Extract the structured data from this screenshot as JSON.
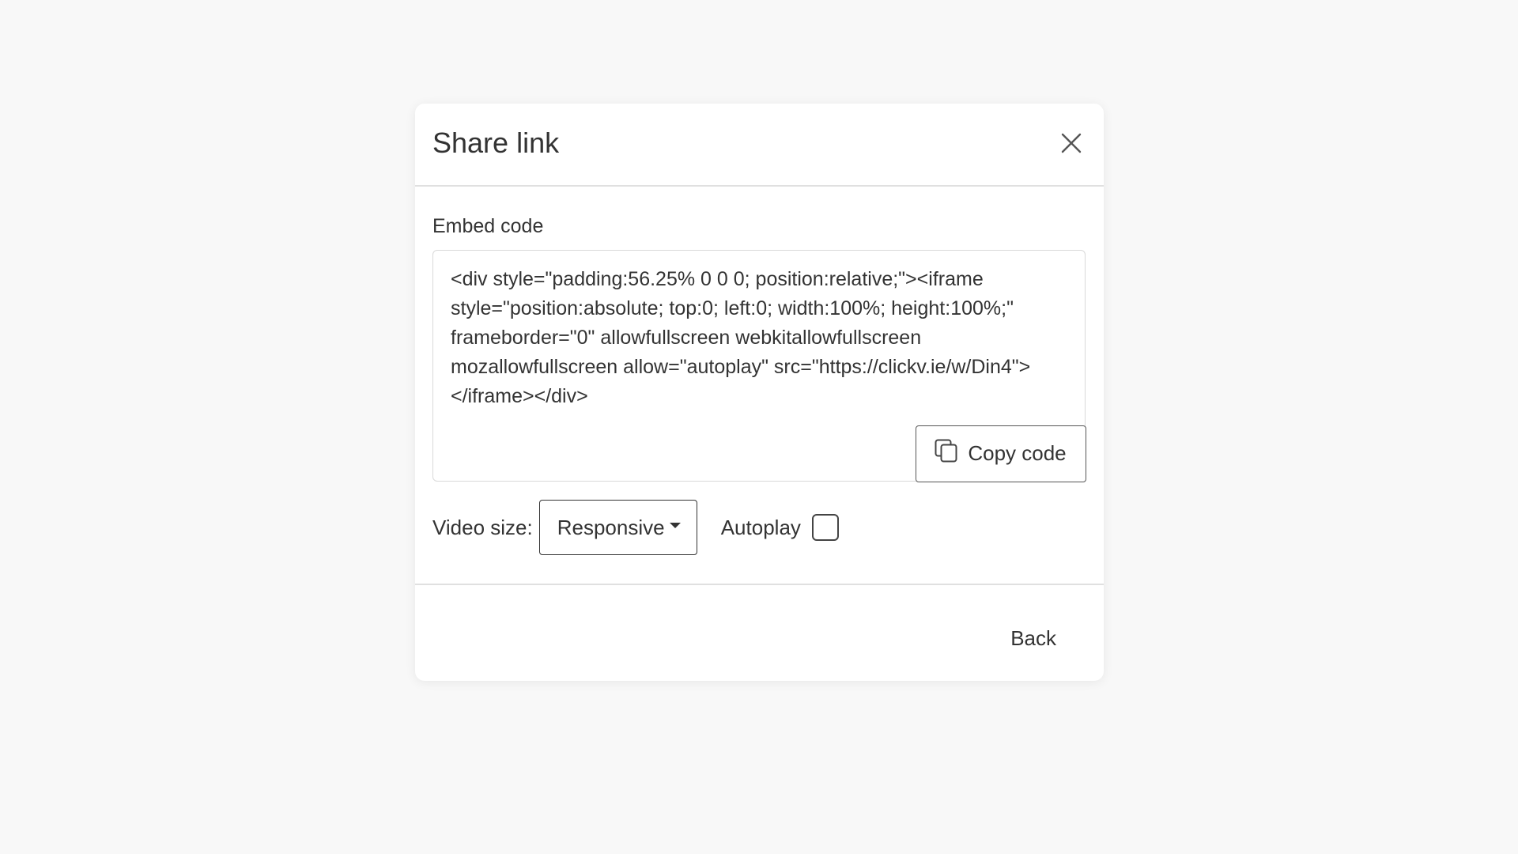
{
  "dialog": {
    "title": "Share link",
    "close_icon": "close-icon"
  },
  "embed": {
    "label": "Embed code",
    "code": "<div style=\"padding:56.25% 0 0 0; position:relative;\"><iframe style=\"position:absolute; top:0; left:0; width:100%; height:100%;\" frameborder=\"0\" allowfullscreen webkitallowfullscreen mozallowfullscreen allow=\"autoplay\" src=\"https://clickv.ie/w/Din4\"></iframe></div>",
    "copy_label": "Copy code",
    "copy_icon": "copy-icon"
  },
  "options": {
    "video_size_label": "Video size:",
    "video_size_value": "Responsive",
    "autoplay_label": "Autoplay",
    "autoplay_checked": false
  },
  "footer": {
    "back_label": "Back"
  },
  "colors": {
    "background": "#f8f8f8",
    "surface": "#ffffff",
    "text": "#333333",
    "divider": "#e0e0e0"
  }
}
